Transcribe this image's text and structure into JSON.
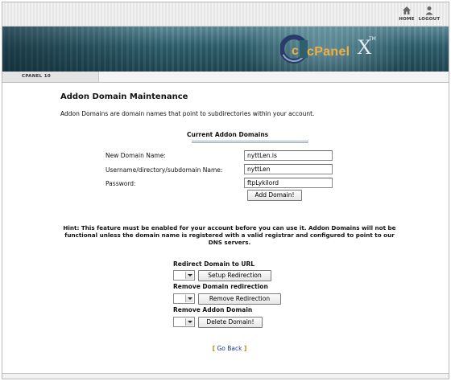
{
  "nav": {
    "home_label": "HOME",
    "logout_label": "LOGOUT",
    "home_icon": "house-icon",
    "logout_icon": "person-icon"
  },
  "banner": {
    "logo_text": "cPanel",
    "logo_x": "X",
    "logo_tm": "TM",
    "colors": {
      "banner": "#2f5f6d",
      "logo_accent": "#f0b040"
    }
  },
  "subheader": {
    "tab_label": "CPANEL 10"
  },
  "page": {
    "title": "Addon Domain Maintenance",
    "intro": "Addon Domains are domain names that point to subdirectories within your account."
  },
  "current_addons": {
    "title": "Current Addon Domains",
    "fields": [
      {
        "label": "New Domain Name:",
        "value": "nyttLen.is"
      },
      {
        "label": "Username/directory/subdomain Name:",
        "value": "nyttLen"
      },
      {
        "label": "Password:",
        "value": "ftpLykilord"
      }
    ],
    "add_button": "Add Domain!"
  },
  "hint": "Hint: This feature must be enabled for your account before you can use it. Addon Domains will not be functional unless the domain name is registered with a valid registrar and configured to point to our DNS servers.",
  "actions": [
    {
      "title": "Redirect Domain to URL",
      "button": "Setup Redirection",
      "selected": ""
    },
    {
      "title": "Remove Domain redirection",
      "button": "Remove Redirection",
      "selected": ""
    },
    {
      "title": "Remove Addon Domain",
      "button": "Delete Domain!",
      "selected": ""
    }
  ],
  "footer": {
    "open_bracket": "[",
    "goback_label": "Go Back",
    "close_bracket": "]"
  }
}
